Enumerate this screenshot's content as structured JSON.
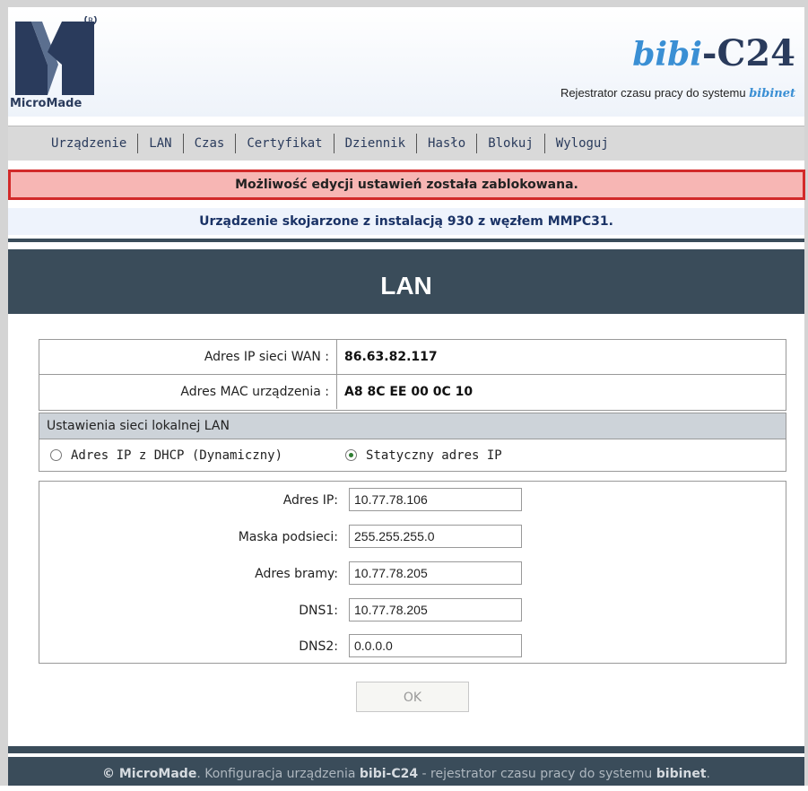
{
  "header": {
    "logo_text": "MicroMade",
    "brand_bibi": "bibi",
    "brand_suffix": "-C24",
    "tagline": "Rejestrator czasu pracy do systemu",
    "tagline_bibinet": "bibinet",
    "logo_icon": "micromade-logo"
  },
  "nav": {
    "items": [
      {
        "label": "Urządzenie"
      },
      {
        "label": "LAN"
      },
      {
        "label": "Czas"
      },
      {
        "label": "Certyfikat"
      },
      {
        "label": "Dziennik"
      },
      {
        "label": "Hasło"
      },
      {
        "label": "Blokuj"
      },
      {
        "label": "Wyloguj"
      }
    ]
  },
  "alert": {
    "text": "Możliwość edycji ustawień została zablokowana.",
    "color": "#d22a2a"
  },
  "info": {
    "text": "Urządzenie skojarzone z instalacją 930 z węzłem MMPC31."
  },
  "page_title": "LAN",
  "device_info": {
    "wan_label": "Adres IP sieci WAN :",
    "wan_value": "86.63.82.117",
    "mac_label": "Adres MAC urządzenia :",
    "mac_value": "A8 8C EE 00 0C 10"
  },
  "lan_section": {
    "title": "Ustawienia sieci lokalnej LAN",
    "dhcp_label": "Adres IP z DHCP (Dynamiczny)",
    "static_label": "Statyczny adres IP",
    "selected": "static"
  },
  "form": {
    "ip_label": "Adres IP:",
    "ip_value": "10.77.78.106",
    "mask_label": "Maska podsieci:",
    "mask_value": "255.255.255.0",
    "gateway_label": "Adres bramy:",
    "gateway_value": "10.77.78.205",
    "dns1_label": "DNS1:",
    "dns1_value": "10.77.78.205",
    "dns2_label": "DNS2:",
    "dns2_value": "0.0.0.0",
    "ok_label": "OK"
  },
  "footer": {
    "copyright": "© MicroMade",
    "text1": ". Konfiguracja urządzenia ",
    "device": "bibi-C24",
    "text2": " - rejestrator czasu pracy do systemu ",
    "system": "bibinet",
    "text3": "."
  }
}
